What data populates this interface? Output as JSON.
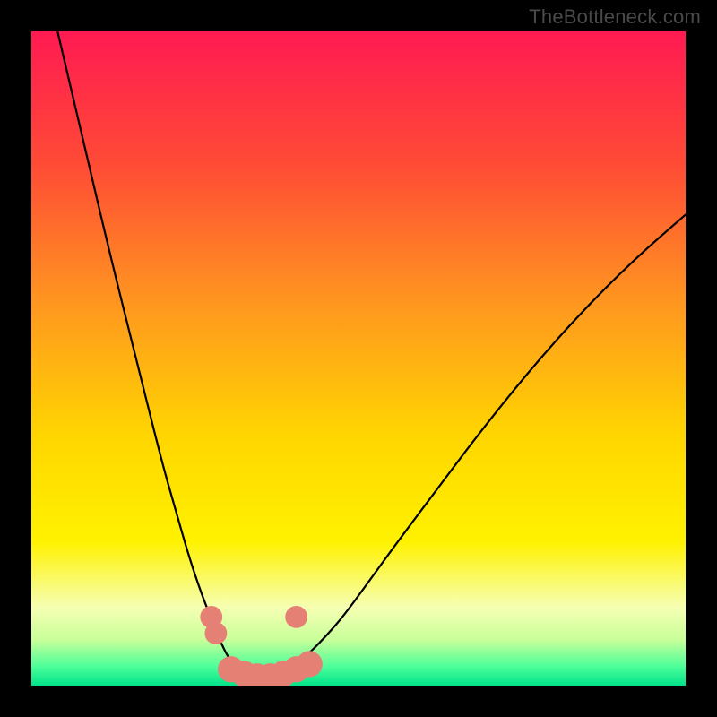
{
  "watermark": "TheBottleneck.com",
  "chart_data": {
    "type": "line",
    "title": "",
    "xlabel": "",
    "ylabel": "",
    "xlim": [
      0,
      100
    ],
    "ylim": [
      0,
      100
    ],
    "grid": false,
    "legend": false,
    "background_gradient_stops": [
      {
        "offset": 0.0,
        "color": "#ff1a52"
      },
      {
        "offset": 0.2,
        "color": "#ff4a36"
      },
      {
        "offset": 0.42,
        "color": "#ff981f"
      },
      {
        "offset": 0.62,
        "color": "#ffd600"
      },
      {
        "offset": 0.78,
        "color": "#fff200"
      },
      {
        "offset": 0.88,
        "color": "#f6ffb3"
      },
      {
        "offset": 0.93,
        "color": "#c8ff9a"
      },
      {
        "offset": 0.97,
        "color": "#4fff9a"
      },
      {
        "offset": 1.0,
        "color": "#00e38a"
      }
    ],
    "series": [
      {
        "name": "left-branch",
        "color": "#000000",
        "width": 2.2,
        "x": [
          4.0,
          8.0,
          12.0,
          16.0,
          20.0,
          22.0,
          24.0,
          26.0,
          28.0,
          29.0,
          30.0,
          31.0,
          32.0,
          33.0
        ],
        "y": [
          100.0,
          83.0,
          66.0,
          50.0,
          34.0,
          27.0,
          20.0,
          14.0,
          9.0,
          6.5,
          4.5,
          3.0,
          2.0,
          1.5
        ]
      },
      {
        "name": "right-branch",
        "color": "#000000",
        "width": 2.2,
        "x": [
          38.0,
          40.0,
          42.0,
          45.0,
          48.0,
          52.0,
          56.0,
          62.0,
          68.0,
          76.0,
          84.0,
          92.0,
          100.0
        ],
        "y": [
          2.0,
          3.0,
          4.5,
          7.5,
          11.0,
          16.5,
          22.0,
          30.0,
          38.0,
          48.0,
          57.0,
          65.0,
          72.0
        ]
      },
      {
        "name": "valley-floor",
        "color": "#000000",
        "width": 2.2,
        "x": [
          33.0,
          34.0,
          35.0,
          36.0,
          37.0,
          38.0
        ],
        "y": [
          1.5,
          1.2,
          1.1,
          1.1,
          1.3,
          2.0
        ]
      }
    ],
    "markers": [
      {
        "name": "dot-left-upper",
        "x": 27.5,
        "y": 10.5,
        "r": 1.7,
        "color": "#e58074"
      },
      {
        "name": "dot-left-lower",
        "x": 28.2,
        "y": 8.0,
        "r": 1.7,
        "color": "#e58074"
      },
      {
        "name": "dot-right-upper",
        "x": 40.5,
        "y": 10.5,
        "r": 1.7,
        "color": "#e58074"
      },
      {
        "name": "dot-floor-1",
        "x": 30.5,
        "y": 2.5,
        "r": 2.0,
        "color": "#e58074"
      },
      {
        "name": "dot-floor-2",
        "x": 32.5,
        "y": 1.8,
        "r": 2.0,
        "color": "#e58074"
      },
      {
        "name": "dot-floor-3",
        "x": 34.5,
        "y": 1.4,
        "r": 2.0,
        "color": "#e58074"
      },
      {
        "name": "dot-floor-4",
        "x": 36.5,
        "y": 1.4,
        "r": 2.0,
        "color": "#e58074"
      },
      {
        "name": "dot-floor-5",
        "x": 38.5,
        "y": 1.8,
        "r": 2.0,
        "color": "#e58074"
      },
      {
        "name": "dot-floor-6",
        "x": 40.5,
        "y": 2.5,
        "r": 2.0,
        "color": "#e58074"
      },
      {
        "name": "dot-floor-7",
        "x": 42.5,
        "y": 3.3,
        "r": 2.0,
        "color": "#e58074"
      }
    ]
  }
}
